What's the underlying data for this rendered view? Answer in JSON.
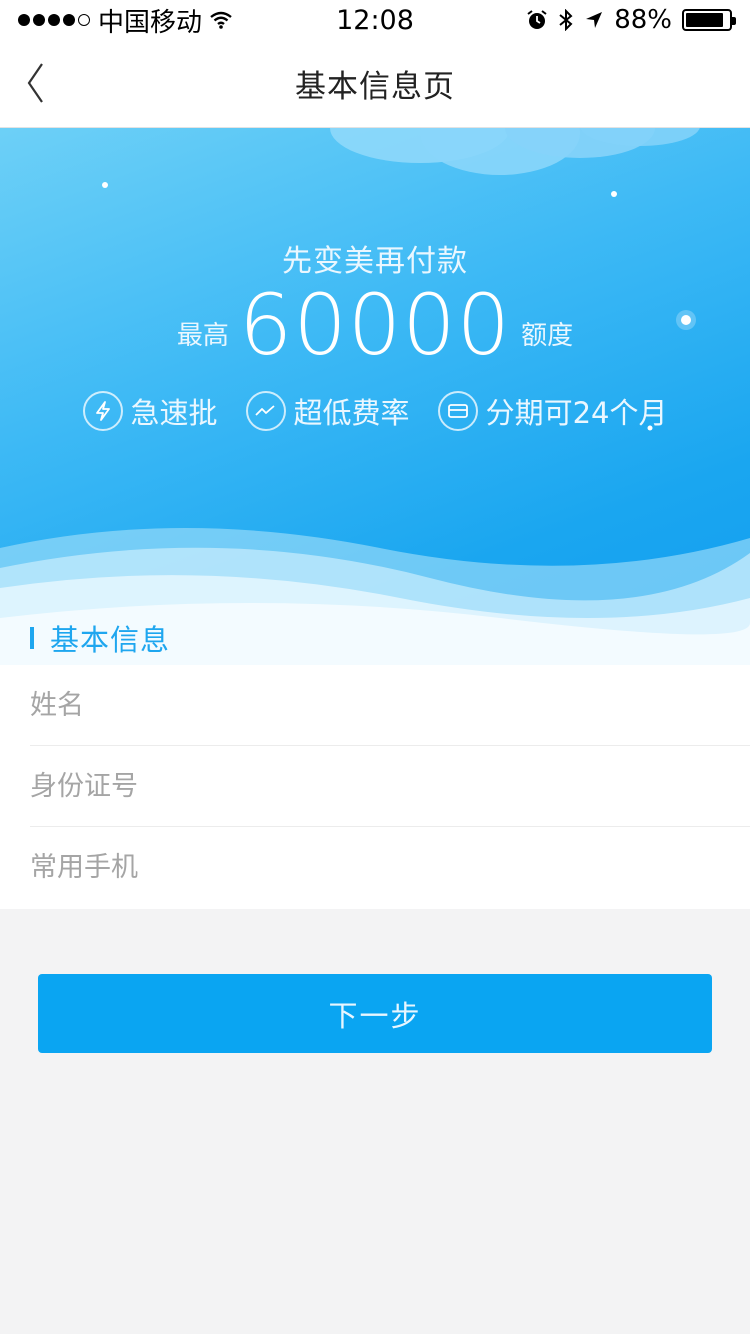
{
  "status_bar": {
    "carrier": "中国移动",
    "time": "12:08",
    "battery_text": "88%",
    "battery_level": 0.88
  },
  "nav": {
    "title": "基本信息页"
  },
  "banner": {
    "slogan": "先变美再付款",
    "limit_prefix": "最高",
    "limit_amount": "60000",
    "limit_suffix": "额度",
    "features": [
      {
        "label": "急速批",
        "icon": "lightning-icon"
      },
      {
        "label": "超低费率",
        "icon": "trend-line-icon"
      },
      {
        "label": "分期可24个月",
        "icon": "card-icon"
      }
    ]
  },
  "section": {
    "title": "基本信息"
  },
  "form": {
    "name_placeholder": "姓名",
    "id_placeholder": "身份证号",
    "phone_placeholder": "常用手机"
  },
  "next_button": {
    "label": "下一步"
  },
  "colors": {
    "accent": "#0aa5f2",
    "section_title": "#1ea6ef",
    "background": "#f3f3f4"
  }
}
